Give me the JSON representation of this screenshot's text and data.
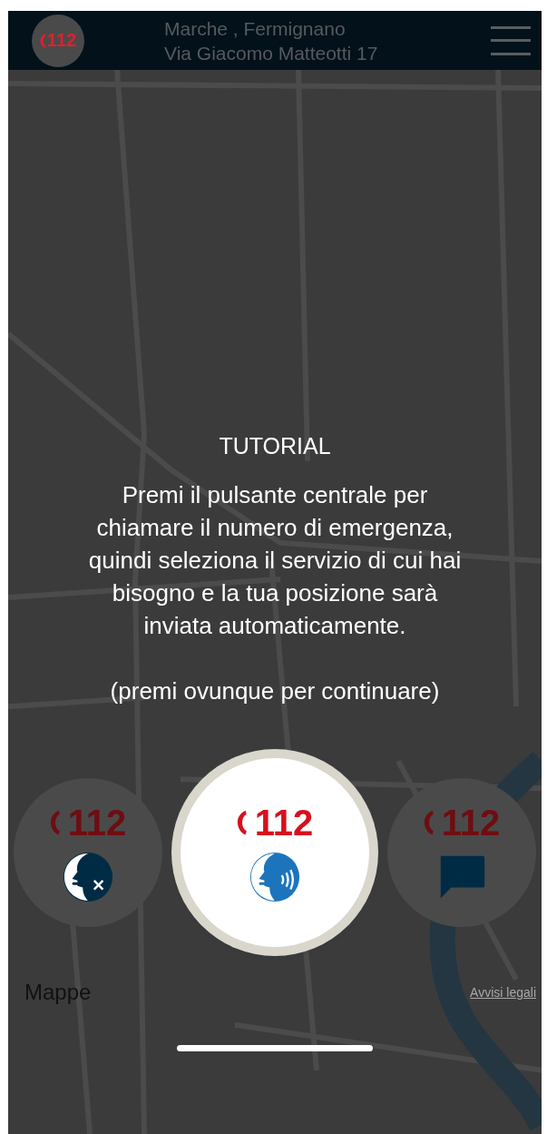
{
  "header": {
    "logo": "112",
    "region": "Marche , Fermignano",
    "address": "Via Giacomo Matteotti 17"
  },
  "tutorial": {
    "title": "TUTORIAL",
    "body": "Premi il pulsante centrale per chiamare il numero di emergenza, quindi seleziona il servizio  di cui hai bisogno e la tua posizione sarà inviata automaticamente.",
    "hint": "(premi ovunque per continuare)"
  },
  "call_buttons": [
    {
      "kind": "voice-off",
      "number": "112",
      "selected": false
    },
    {
      "kind": "voice",
      "number": "112",
      "selected": true
    },
    {
      "kind": "chat",
      "number": "112",
      "selected": false
    }
  ],
  "map": {
    "brand": "Mappe",
    "legal_link": "Avvisi legali"
  }
}
